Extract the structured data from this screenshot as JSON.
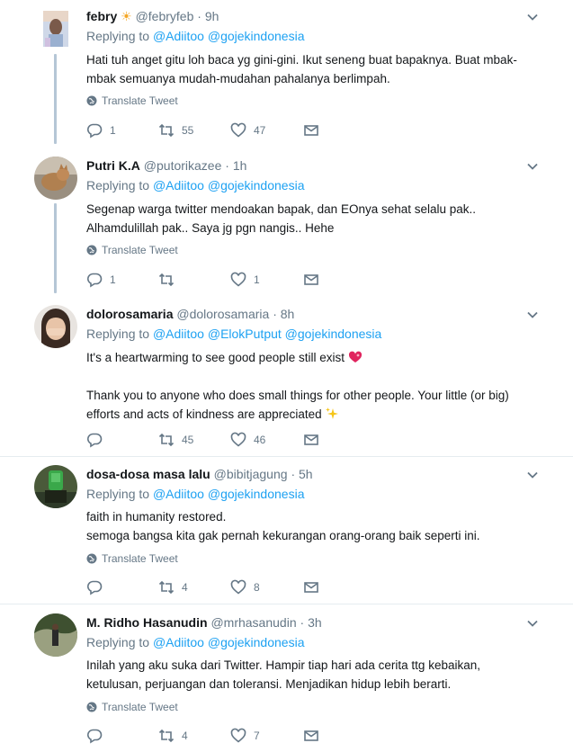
{
  "tweets": [
    {
      "name": "febry",
      "name_emoji": "☀",
      "handle": "@febryfeb",
      "time": "9h",
      "replying_prefix": "Replying to",
      "mentions": [
        "@Adiitoo",
        "@gojekindonesia"
      ],
      "lines": [
        "Hati tuh anget gitu loh baca yg gini-gini. Ikut seneng buat bapaknya. Buat mbak-",
        "mbak semuanya mudah-mudahan pahalanya berlimpah."
      ],
      "translate": "Translate Tweet",
      "replies": "1",
      "retweets": "55",
      "likes": "47"
    },
    {
      "name": "Putri K.A",
      "handle": "@putorikazee",
      "time": "1h",
      "replying_prefix": "Replying to",
      "mentions": [
        "@Adiitoo",
        "@gojekindonesia"
      ],
      "lines": [
        "Segenap warga twitter mendoakan bapak, dan EOnya sehat selalu pak..",
        "Alhamdulillah pak.. Saya jg pgn nangis.. Hehe"
      ],
      "translate": "Translate Tweet",
      "replies": "1",
      "retweets": "",
      "likes": "1"
    },
    {
      "name": "dolorosamaria",
      "handle": "@dolorosamaria",
      "time": "8h",
      "replying_prefix": "Replying to",
      "mentions": [
        "@Adiitoo",
        "@ElokPutput",
        "@gojekindonesia"
      ],
      "lines": [
        "It's a heartwarming to see good people still exist",
        "",
        "Thank you to anyone who does small things for other people. Your little (or big)",
        "efforts and acts of kindness are appreciated"
      ],
      "replies": "",
      "retweets": "45",
      "likes": "46"
    },
    {
      "name": "dosa-dosa masa lalu",
      "handle": "@bibitjagung",
      "time": "5h",
      "replying_prefix": "Replying to",
      "mentions": [
        "@Adiitoo",
        "@gojekindonesia"
      ],
      "lines": [
        "faith in humanity restored.",
        "semoga bangsa kita gak pernah kekurangan orang-orang baik seperti ini."
      ],
      "translate": "Translate Tweet",
      "replies": "",
      "retweets": "4",
      "likes": "8"
    },
    {
      "name": "M. Ridho Hasanudin",
      "handle": "@mrhasanudin",
      "time": "3h",
      "replying_prefix": "Replying to",
      "mentions": [
        "@Adiitoo",
        "@gojekindonesia"
      ],
      "lines": [
        "Inilah yang aku suka dari Twitter. Hampir tiap hari ada cerita ttg kebaikan,",
        "ketulusan, perjuangan dan toleransi. Menjadikan hidup lebih berarti."
      ],
      "translate": "Translate Tweet",
      "replies": "",
      "retweets": "4",
      "likes": "7"
    }
  ],
  "icons": {
    "reply": "reply-icon",
    "retweet": "retweet-icon",
    "like": "heart-icon",
    "dm": "envelope-icon",
    "translate": "globe-icon",
    "more": "chevron-down-icon"
  },
  "colors": {
    "link": "#1da1f2",
    "muted": "#657786",
    "thread": "#b5c6d6"
  }
}
